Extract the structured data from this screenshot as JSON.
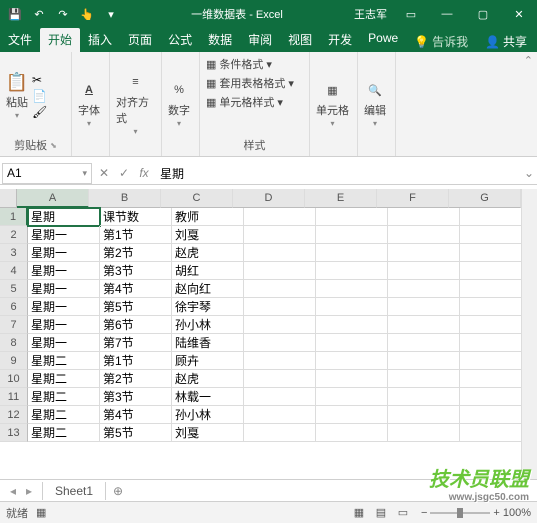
{
  "titlebar": {
    "title": "一维数据表 - Excel",
    "user": "王志军"
  },
  "tabs": [
    "文件",
    "开始",
    "插入",
    "页面",
    "公式",
    "数据",
    "审阅",
    "视图",
    "开发",
    "Powe"
  ],
  "tell_me": "告诉我",
  "share": "共享",
  "ribbon": {
    "clipboard": "剪贴板",
    "paste": "粘贴",
    "font": "字体",
    "align": "对齐方式",
    "number": "数字",
    "styles": "样式",
    "cond_fmt": "条件格式",
    "tbl_fmt": "套用表格格式",
    "cell_fmt": "单元格样式",
    "cells": "单元格",
    "editing": "编辑"
  },
  "formula_bar": {
    "name": "A1",
    "value": "星期"
  },
  "columns": [
    "A",
    "B",
    "C",
    "D",
    "E",
    "F",
    "G"
  ],
  "rows": [
    [
      "星期",
      "课节数",
      "教师",
      "",
      "",
      "",
      ""
    ],
    [
      "星期一",
      "第1节",
      "刘戛",
      "",
      "",
      "",
      ""
    ],
    [
      "星期一",
      "第2节",
      "赵虎",
      "",
      "",
      "",
      ""
    ],
    [
      "星期一",
      "第3节",
      "胡红",
      "",
      "",
      "",
      ""
    ],
    [
      "星期一",
      "第4节",
      "赵向红",
      "",
      "",
      "",
      ""
    ],
    [
      "星期一",
      "第5节",
      "徐宇琴",
      "",
      "",
      "",
      ""
    ],
    [
      "星期一",
      "第6节",
      "孙小林",
      "",
      "",
      "",
      ""
    ],
    [
      "星期一",
      "第7节",
      "陆维香",
      "",
      "",
      "",
      ""
    ],
    [
      "星期二",
      "第1节",
      "顾卉",
      "",
      "",
      "",
      ""
    ],
    [
      "星期二",
      "第2节",
      "赵虎",
      "",
      "",
      "",
      ""
    ],
    [
      "星期二",
      "第3节",
      "林载一",
      "",
      "",
      "",
      ""
    ],
    [
      "星期二",
      "第4节",
      "孙小林",
      "",
      "",
      "",
      ""
    ],
    [
      "星期二",
      "第5节",
      "刘戛",
      "",
      "",
      "",
      ""
    ]
  ],
  "sheet": "Sheet1",
  "status": "就绪",
  "zoom": "100%",
  "watermark": "技术员联盟",
  "watermark_sub": "www.jsgc50.com"
}
